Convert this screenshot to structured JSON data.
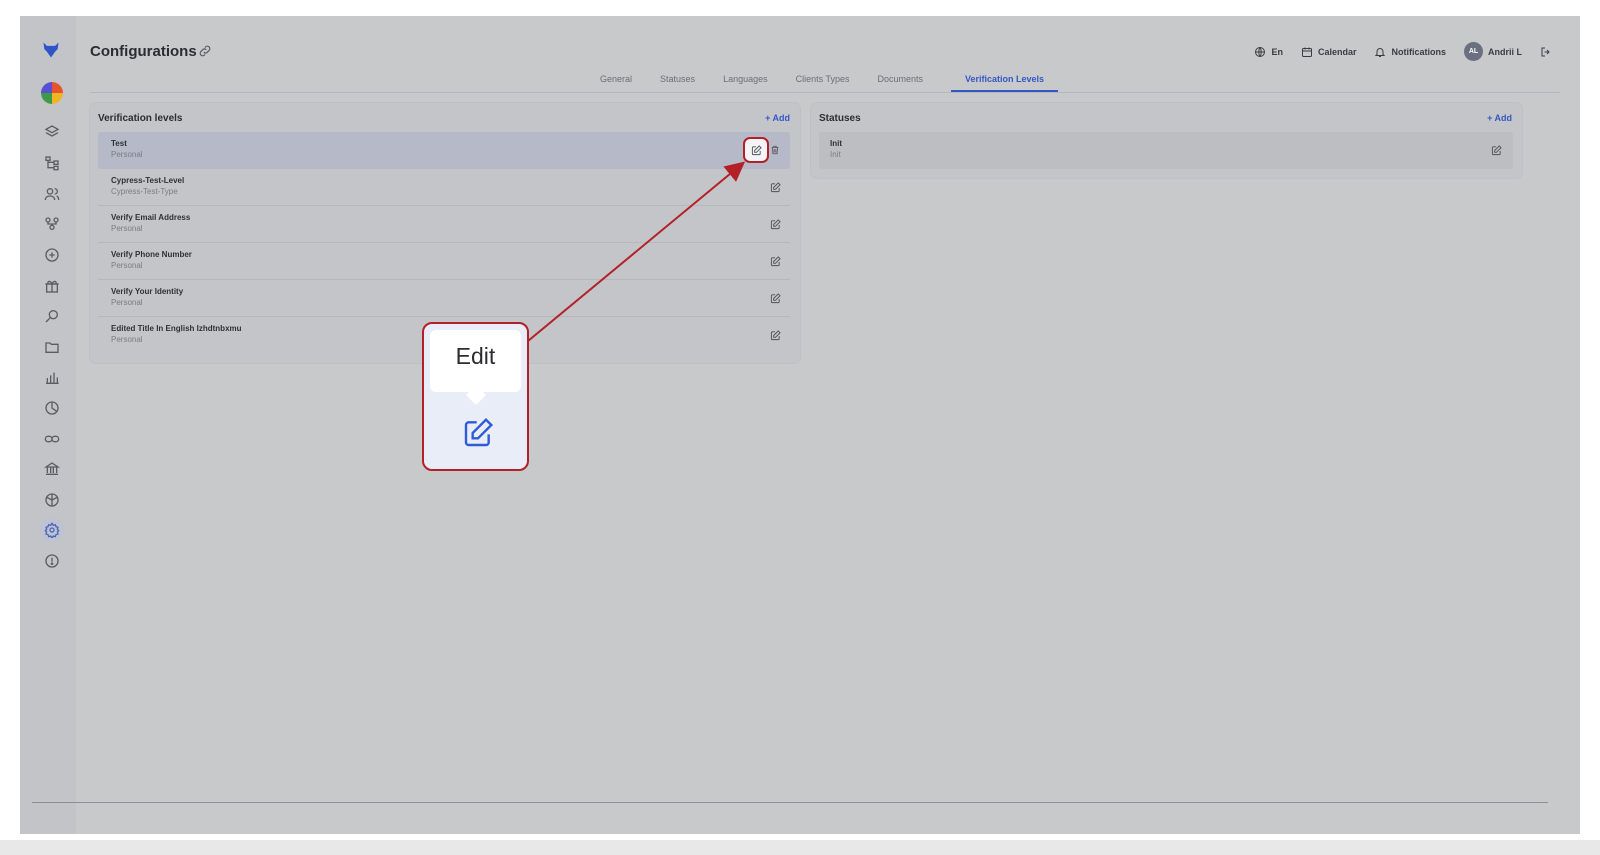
{
  "page": {
    "title": "Configurations"
  },
  "topbar": {
    "language": "En",
    "calendar": "Calendar",
    "notifications": "Notifications",
    "user_initials": "AL",
    "user_name": "Andrii L"
  },
  "tabs": [
    {
      "label": "General",
      "active": false
    },
    {
      "label": "Statuses",
      "active": false
    },
    {
      "label": "Languages",
      "active": false
    },
    {
      "label": "Clients Types",
      "active": false
    },
    {
      "label": "Documents",
      "active": false
    },
    {
      "label": "Verification Levels",
      "active": true
    }
  ],
  "verification_levels": {
    "title": "Verification levels",
    "add_label": "+ Add",
    "rows": [
      {
        "name": "Test",
        "type": "Personal",
        "selected": true
      },
      {
        "name": "Cypress-Test-Level",
        "type": "Cypress-Test-Type",
        "selected": false
      },
      {
        "name": "Verify Email Address",
        "type": "Personal",
        "selected": false
      },
      {
        "name": "Verify Phone Number",
        "type": "Personal",
        "selected": false
      },
      {
        "name": "Verify Your Identity",
        "type": "Personal",
        "selected": false
      },
      {
        "name": "Edited Title In English Izhdtnbxmu",
        "type": "Personal",
        "selected": false
      }
    ]
  },
  "statuses": {
    "title": "Statuses",
    "add_label": "+ Add",
    "rows": [
      {
        "name": "Init",
        "type": "Init"
      }
    ]
  },
  "callout": {
    "label": "Edit",
    "icon": "edit-icon"
  },
  "colors": {
    "accent": "#3458c6",
    "highlight": "#b32028",
    "arrow": "#b32028"
  }
}
